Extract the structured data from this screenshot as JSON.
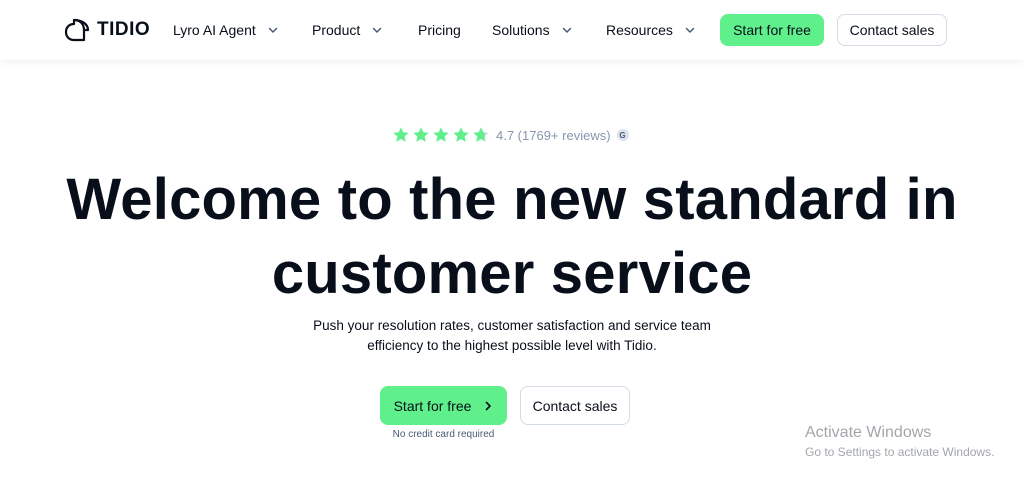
{
  "brand": {
    "name": "TIDIO"
  },
  "nav": {
    "items": [
      {
        "label": "Lyro AI Agent",
        "has_dropdown": true
      },
      {
        "label": "Product",
        "has_dropdown": true
      },
      {
        "label": "Pricing",
        "has_dropdown": false
      },
      {
        "label": "Solutions",
        "has_dropdown": true
      },
      {
        "label": "Resources",
        "has_dropdown": true
      }
    ],
    "start_label": "Start for free",
    "contact_label": "Contact sales"
  },
  "hero": {
    "rating_value": "4.7",
    "rating_count": "(1769+ reviews)",
    "rating_text": "4.7 (1769+ reviews)",
    "stars": 4.7,
    "review_badge": "G",
    "headline": "Welcome to the new standard in customer service",
    "subtext": "Push your resolution rates, customer satisfaction and service team efficiency to the highest possible level with Tidio.",
    "cta_primary": "Start for free",
    "cta_secondary": "Contact sales",
    "note": "No credit card required"
  },
  "watermark": {
    "title": "Activate Windows",
    "subtitle": "Go to Settings to activate Windows."
  },
  "colors": {
    "accent": "#5ff08b",
    "text": "#080f1a",
    "muted": "#8796af",
    "border": "#d3dbe5"
  }
}
